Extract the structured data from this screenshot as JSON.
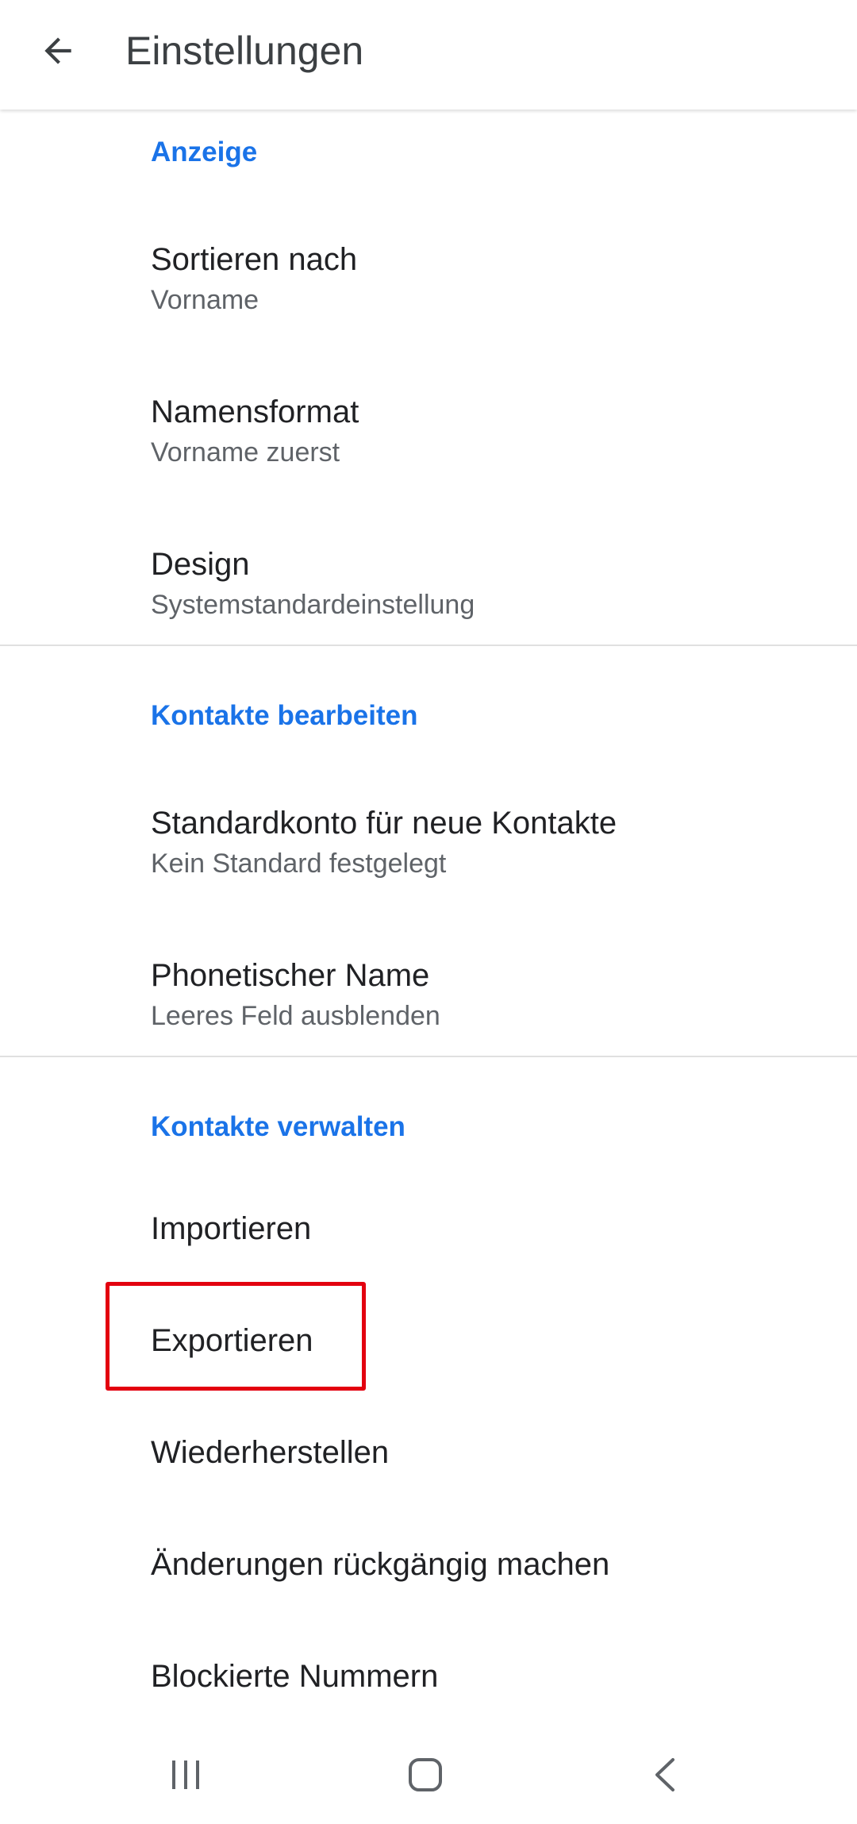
{
  "app_bar": {
    "title": "Einstellungen",
    "back_icon": "arrow-back-icon"
  },
  "sections": {
    "display": {
      "header": "Anzeige",
      "items": [
        {
          "title": "Sortieren nach",
          "summary": "Vorname"
        },
        {
          "title": "Namensformat",
          "summary": "Vorname zuerst"
        },
        {
          "title": "Design",
          "summary": "Systemstandardeinstellung"
        }
      ]
    },
    "edit": {
      "header": "Kontakte bearbeiten",
      "items": [
        {
          "title": "Standardkonto für neue Kontakte",
          "summary": "Kein Standard festgelegt"
        },
        {
          "title": "Phonetischer Name",
          "summary": "Leeres Feld ausblenden"
        }
      ]
    },
    "manage": {
      "header": "Kontakte verwalten",
      "items": [
        {
          "title": "Importieren"
        },
        {
          "title": "Exportieren"
        },
        {
          "title": "Wiederherstellen"
        },
        {
          "title": "Änderungen rückgängig machen"
        },
        {
          "title": "Blockierte Nummern"
        }
      ]
    }
  },
  "nav_bar": {
    "recents_icon": "recent-apps-icon",
    "home_icon": "home-icon",
    "back_icon": "nav-back-icon"
  },
  "colors": {
    "accent": "#1a73e8",
    "highlight": "#e3000f",
    "title_text": "#202124",
    "summary_text": "#5f6368",
    "divider": "#e0e0e0"
  }
}
